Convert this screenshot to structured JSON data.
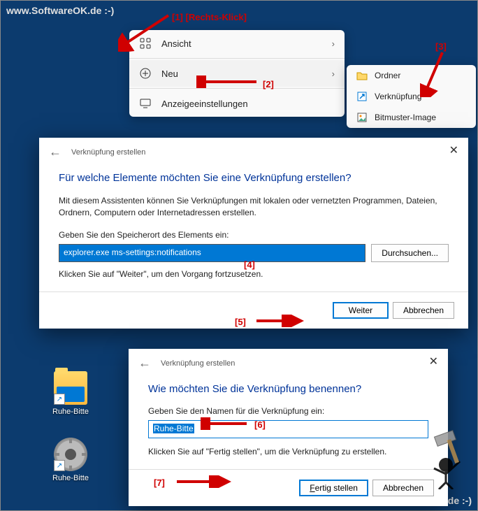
{
  "watermark": "www.SoftwareOK.de :-)",
  "annotations": {
    "a1": "[1]  [Rechts-Klick]",
    "a2": "[2]",
    "a3": "[3]",
    "a4": "[4]",
    "a5": "[5]",
    "a6": "[6]",
    "a7": "[7]"
  },
  "context_menu": {
    "items": [
      {
        "label": "Ansicht",
        "has_chevron": true
      },
      {
        "label": "Neu",
        "has_chevron": true
      },
      {
        "label": "Anzeigeeinstellungen",
        "has_chevron": false
      }
    ]
  },
  "submenu": {
    "items": [
      {
        "label": "Ordner"
      },
      {
        "label": "Verknüpfung"
      },
      {
        "label": "Bitmuster-Image"
      }
    ]
  },
  "dialog1": {
    "breadcrumb": "Verknüpfung erstellen",
    "title": "Für welche Elemente möchten Sie eine Verknüpfung erstellen?",
    "desc": "Mit diesem Assistenten können Sie Verknüpfungen mit lokalen oder vernetzten Programmen, Dateien, Ordnern, Computern oder Internetadressen erstellen.",
    "input_label": "Geben Sie den Speicherort des Elements ein:",
    "input_value": "explorer.exe ms-settings:notifications",
    "browse_btn": "Durchsuchen...",
    "hint": "Klicken Sie auf \"Weiter\", um den Vorgang fortzusetzen.",
    "next_btn": "Weiter",
    "cancel_btn": "Abbrechen"
  },
  "dialog2": {
    "breadcrumb": "Verknüpfung erstellen",
    "title": "Wie möchten Sie die Verknüpfung benennen?",
    "input_label": "Geben Sie den Namen für die Verknüpfung ein:",
    "input_value": "Ruhe-Bitte",
    "hint": "Klicken Sie auf \"Fertig stellen\", um die Verknüpfung zu erstellen.",
    "finish_btn": "Fertig stellen",
    "cancel_btn": "Abbrechen"
  },
  "desktop": {
    "icon1_label": "Ruhe-Bitte",
    "icon2_label": "Ruhe-Bitte"
  }
}
